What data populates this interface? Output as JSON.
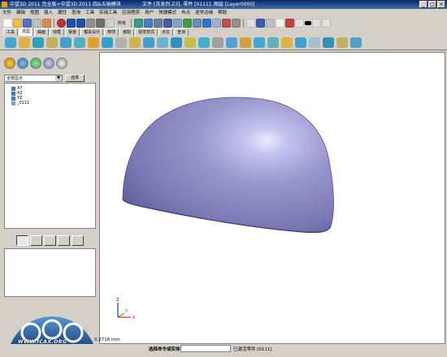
{
  "window": {
    "title": "中望3D 2011 完全版+中望3D 2011 四&五轴模块",
    "file_info": "文件 [洗发剂.Z3], 零件 [0111], 图层 [Layer0000]"
  },
  "menu": [
    "文件",
    "编辑",
    "视图",
    "插入",
    "属性",
    "查询",
    "工具",
    "实用工具",
    "应用程序",
    "用户",
    "快捷模式",
    "布点",
    "逆学边缘",
    "帮助"
  ],
  "toolbar": {
    "style_label": "所有"
  },
  "tabs": [
    "工具",
    "造型",
    "曲面",
    "线框",
    "钣金",
    "模具设计",
    "修改",
    "装配",
    "视觉样式",
    "点云",
    "查询"
  ],
  "active_tab": "造型",
  "left_panel": {
    "filter_value": "全部显示",
    "select_button": "选择",
    "tree": [
      {
        "label": "XY",
        "type": "plane"
      },
      {
        "label": "XZ",
        "type": "plane"
      },
      {
        "label": "YZ",
        "type": "plane"
      },
      {
        "label": "_0111",
        "type": "sheet"
      }
    ]
  },
  "status": {
    "command_prompt": "选择命令或实体",
    "message": "已激活零件 [0111]",
    "coordinate": "0.2716 mm"
  },
  "axes": {
    "x": "X",
    "y": "Y",
    "z": "Z"
  },
  "watermark": "WWW.ICAX.ORG",
  "colors": {
    "shape": "#8b89c0",
    "title_bar": "#0a246a",
    "chrome": "#d4d0c8"
  }
}
